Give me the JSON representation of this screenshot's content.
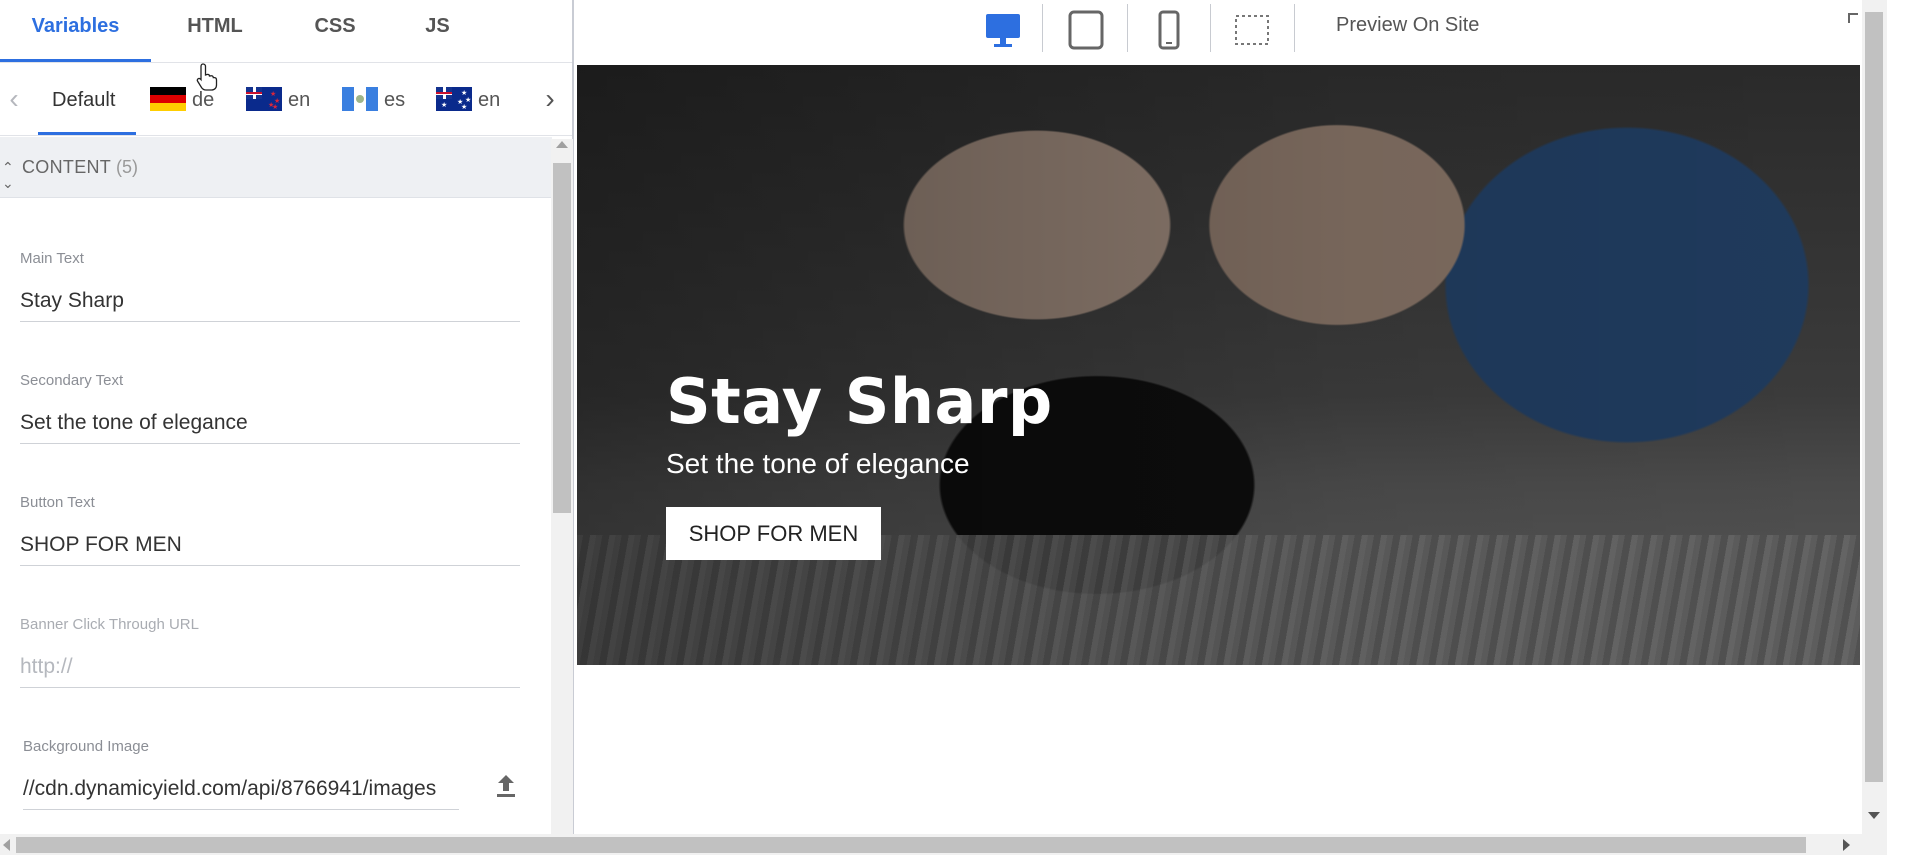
{
  "code_tabs": [
    {
      "label": "Variables",
      "active": true
    },
    {
      "label": "HTML",
      "active": false
    },
    {
      "label": "CSS",
      "active": false
    },
    {
      "label": "JS",
      "active": false
    }
  ],
  "languages": [
    {
      "label": "Default",
      "flag": "none",
      "active": true
    },
    {
      "label": "de",
      "flag": "germany-flag"
    },
    {
      "label": "en",
      "flag": "new-zealand-flag"
    },
    {
      "label": "es",
      "flag": "guatemala-flag"
    },
    {
      "label": "en",
      "flag": "australia-flag"
    }
  ],
  "section": {
    "title": "CONTENT",
    "count": "(5)"
  },
  "fields": [
    {
      "label": "Main Text",
      "value": "Stay Sharp",
      "placeholder": ""
    },
    {
      "label": "Secondary Text",
      "value": "Set the tone of elegance",
      "placeholder": ""
    },
    {
      "label": "Button Text",
      "value": "SHOP FOR MEN",
      "placeholder": ""
    },
    {
      "label": "Banner Click Through URL",
      "value": "",
      "placeholder": "http://"
    },
    {
      "label": "Background Image",
      "value": "//cdn.dynamicyield.com/api/8766941/images",
      "placeholder": ""
    }
  ],
  "toolbar": {
    "devices": [
      "desktop-icon",
      "tablet-icon",
      "mobile-icon",
      "custom-size-icon"
    ],
    "active_device": "desktop-icon",
    "preview_label": "Preview On Site"
  },
  "banner": {
    "title": "Stay Sharp",
    "subtitle": "Set the tone of elegance",
    "button": "SHOP FOR MEN"
  },
  "colors": {
    "accent": "#2d6fe0",
    "panel_header": "#eef0f3"
  }
}
